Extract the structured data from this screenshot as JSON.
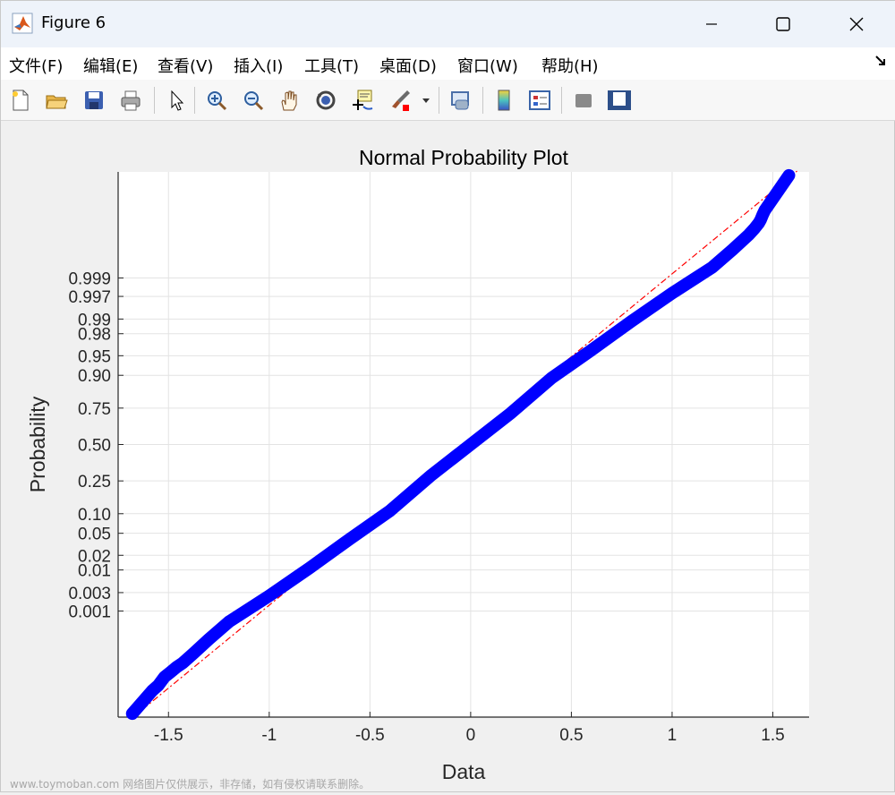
{
  "window": {
    "title": "Figure 6"
  },
  "menu": [
    "文件(F)",
    "编辑(E)",
    "查看(V)",
    "插入(I)",
    "工具(T)",
    "桌面(D)",
    "窗口(W)",
    "帮助(H)"
  ],
  "toolbar_icons": [
    "new-figure-icon",
    "open-file-icon",
    "save-icon",
    "print-icon",
    "select-arrow-icon",
    "zoom-in-icon",
    "zoom-out-icon",
    "pan-hand-icon",
    "rotate-3d-icon",
    "data-cursor-icon",
    "brush-icon",
    "brush-dropdown-icon",
    "link-plot-icon",
    "colorbar-icon",
    "legend-icon",
    "hide-plot-tools-icon",
    "show-plot-tools-icon"
  ],
  "watermark": "www.toymoban.com 网络图片仅供展示，非存储，如有侵权请联系删除。",
  "chart_data": {
    "type": "scatter",
    "title": "Normal Probability Plot",
    "xlabel": "Data",
    "ylabel": "Probability",
    "xlim": [
      -1.75,
      1.68
    ],
    "xticks": [
      "-1.5",
      "-1",
      "-0.5",
      "0",
      "0.5",
      "1",
      "1.5"
    ],
    "yticks": [
      "0.001",
      "0.003",
      "0.01",
      "0.02",
      "0.05",
      "0.10",
      "0.25",
      "0.50",
      "0.75",
      "0.90",
      "0.95",
      "0.98",
      "0.99",
      "0.997",
      "0.999"
    ],
    "grid": true,
    "series": [
      {
        "marker": "+",
        "color": "#0000ff",
        "x": [
          -1.68,
          -1.58,
          -1.55,
          -1.52,
          -1.49,
          -1.46,
          -1.43,
          -1.38,
          -1.3,
          -1.2,
          -1.0,
          -0.8,
          -0.6,
          -0.4,
          -0.2,
          0.0,
          0.2,
          0.4,
          0.6,
          0.8,
          1.0,
          1.2,
          1.3,
          1.38,
          1.41,
          1.43,
          1.44,
          1.45,
          1.46,
          1.58
        ],
        "y": [
          3e-07,
          2.5e-06,
          4e-06,
          8e-06,
          1.2e-05,
          1.8e-05,
          2.5e-05,
          5e-05,
          0.00015,
          0.0005,
          0.0025,
          0.011,
          0.04,
          0.11,
          0.28,
          0.5,
          0.72,
          0.89,
          0.96,
          0.989,
          0.9975,
          0.9995,
          0.99985,
          0.99995,
          0.99997,
          0.99998,
          0.999985,
          0.99999,
          0.999993,
          0.9999997
        ]
      },
      {
        "style": "dash-dot",
        "color": "#ff0000",
        "x": [
          -1.68,
          1.62
        ],
        "y": [
          2e-07,
          0.9999998
        ]
      }
    ]
  }
}
